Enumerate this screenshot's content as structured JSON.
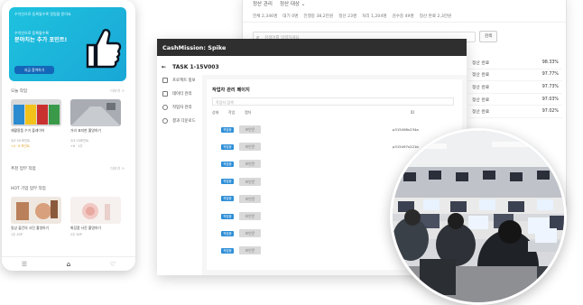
{
  "back_window": {
    "nav_title": "정산 관리",
    "nav_dropdown": "정산 대상 ⌄",
    "filters": [
      "전체 2,346명",
      "대기 0명",
      "진행중 38,2만원",
      "정산 23명",
      "처리 1,204명",
      "검수중 49명",
      "정산 완료 2,3만원"
    ],
    "search_placeholder": "검색어를 입력하세요",
    "search_button": "검색",
    "rows": [
      {
        "status": "정산 완료",
        "percent": "98.33%"
      },
      {
        "status": "정산 완료",
        "percent": "97.77%"
      },
      {
        "status": "정산 완료",
        "percent": "97.73%"
      },
      {
        "status": "정산 완료",
        "percent": "97.03%"
      },
      {
        "status": "정산 완료",
        "percent": "97.02%"
      }
    ]
  },
  "front_window": {
    "title": "CashMission: Spike",
    "back_label": "TASK 1-15V003",
    "sidebar": [
      "프로젝트 정보",
      "데이터 관리",
      "작업자 관리",
      "결과 다운로드"
    ],
    "panel_title": "작업자 관리 페이지",
    "panel_input_placeholder": "작업자 검색",
    "table_headers": [
      "상태",
      "작업",
      "캡차",
      "ID"
    ],
    "rows": [
      {
        "tag": "작업중",
        "captcha": "보안문",
        "id": "p315498v234a"
      },
      {
        "tag": "작업중",
        "captcha": "보안문",
        "id": "p315497x221b"
      },
      {
        "tag": "작업중",
        "captcha": "보안문",
        "id": ""
      },
      {
        "tag": "작업중",
        "captcha": "보안문",
        "id": ""
      },
      {
        "tag": "작업중",
        "captcha": "보안문",
        "id": ""
      },
      {
        "tag": "작업중",
        "captcha": "보안문",
        "id": ""
      },
      {
        "tag": "작업중",
        "captcha": "보안문",
        "id": ""
      },
      {
        "tag": "작업중",
        "captcha": "보안문",
        "id": ""
      }
    ]
  },
  "phone": {
    "banner_top": "수익인으로 등록될수록 알림을 받아요",
    "banner_sub": "수익인으로 등록될수록",
    "banner_heading": "분야치는 추가 포인트!",
    "banner_button": "지금 참여하기",
    "section1_title": "오늘 작업",
    "section1_more": "더보기 >",
    "cards1": [
      {
        "title": "재활용품 수거 플레이어",
        "meta": "3/3 50 포인트",
        "meta2": "+4 · 8 포인트"
      },
      {
        "title": "거리 표지판 촬영하기",
        "meta": "2/3 20포인트",
        "meta2": "+6 · 1주"
      }
    ],
    "section2_title": "추천 업무 작업",
    "section2_more": "더보기 >",
    "section3_title": "HOT 기업 업무 작업",
    "cards2": [
      {
        "title": "일상 물건의 사진 촬영하기",
        "meta": "1주 20P"
      },
      {
        "title": "화장품 사진 촬영하기",
        "meta": "2주 30P"
      }
    ],
    "nav": [
      "☰",
      "⌂",
      "♡"
    ]
  },
  "colors": {
    "accent": "#2f8fd8",
    "banner": "#1ec2df",
    "titlebar": "#2f2f2f"
  }
}
